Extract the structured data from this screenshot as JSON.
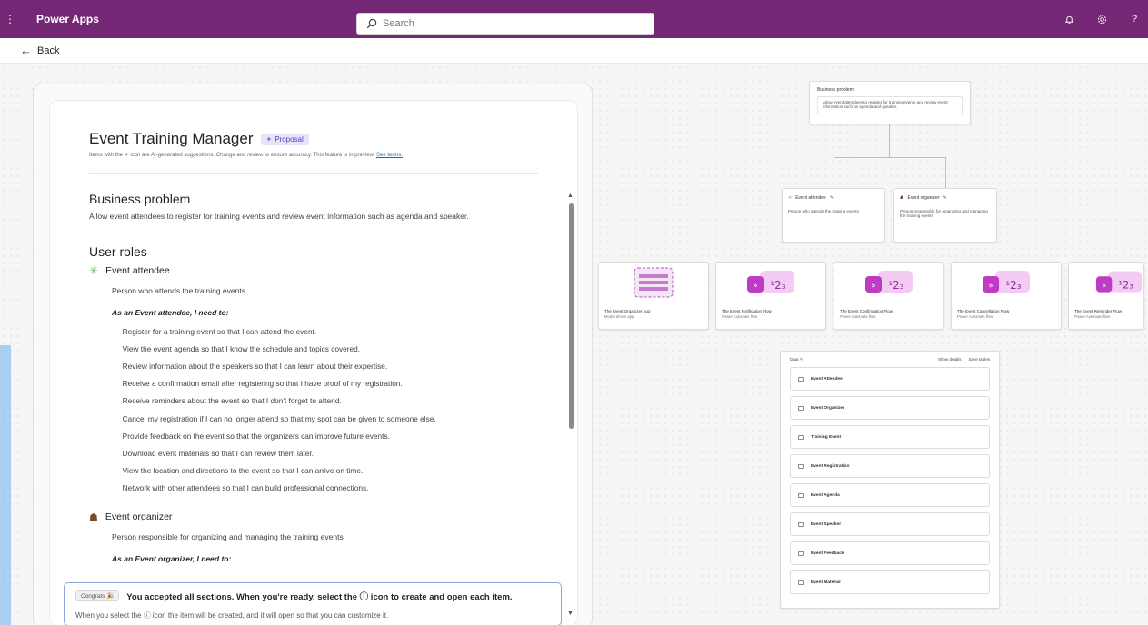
{
  "header": {
    "app_name": "Power Apps",
    "search_placeholder": "Search",
    "icons": [
      "waffle-icon",
      "bell-icon",
      "settings-icon",
      "help-icon"
    ],
    "help_label": "?"
  },
  "back": {
    "label": "Back"
  },
  "plan": {
    "title": "Event Training Manager",
    "badge": "Proposal",
    "ai_note": "Items with the ✦ icon are AI-generated suggestions. Change and review to ensure accuracy. This feature is in preview.",
    "ai_note_link": "See terms.",
    "business_problem_title": "Business problem",
    "business_problem_text": "Allow event attendees to register for training events and review event information such as agenda and speaker.",
    "user_roles_title": "User roles",
    "roles": [
      {
        "name": "Event attendee",
        "description": "Person who attends the training events",
        "need_title": "As an Event attendee, I need to:",
        "stories": [
          "Register for a training event so that I can attend the event.",
          "View the event agenda so that I know the schedule and topics covered.",
          "Review information about the speakers so that I can learn about their expertise.",
          "Receive a confirmation email after registering so that I have proof of my registration.",
          "Receive reminders about the event so that I don't forget to attend.",
          "Cancel my registration if I can no longer attend so that my spot can be given to someone else.",
          "Provide feedback on the event so that the organizers can improve future events.",
          "Download event materials so that I can review them later.",
          "View the location and directions to the event so that I can arrive on time.",
          "Network with other attendees so that I can build professional connections."
        ]
      },
      {
        "name": "Event organizer",
        "description": "Person responsible for organizing and managing the training events",
        "need_title": "As an Event organizer, I need to:"
      }
    ]
  },
  "toast": {
    "badge": "Congrats",
    "message": "You accepted all sections. When you're ready, select the ⓘ icon to create and open each item.",
    "sub": "When you select the ⓘ icon the item will be created, and it will open so that you can customize it."
  },
  "diagram": {
    "business_problem": {
      "title": "Business problem",
      "text": "Allow event attendees to register for training events and review event information such as agenda and speaker."
    },
    "roles": [
      {
        "name": "Event attendee",
        "description": "Person who attends the training events"
      },
      {
        "name": "Event organizer",
        "description": "Person responsible for organizing and managing the training events"
      }
    ],
    "apps": [
      {
        "name": "The Event Organizer App",
        "type": "Model-driven app"
      },
      {
        "name": "The Event Notification Flow",
        "type": "Power Automate flow"
      },
      {
        "name": "The Event Confirmation Flow",
        "type": "Power Automate flow"
      },
      {
        "name": "The Event Cancellation Flow",
        "type": "Power Automate flow"
      },
      {
        "name": "The Event Reminder Flow",
        "type": "Power Automate flow"
      }
    ],
    "tables_title": "Data",
    "show_details": "Show details",
    "save_tables": "Save tables",
    "tables": [
      "Event Attendee",
      "Event Organizer",
      "Training Event",
      "Event Registration",
      "Event Agenda",
      "Event Speaker",
      "Event Feedback",
      "Event Material"
    ]
  },
  "colors": {
    "header_bg": "#742774",
    "accent": "#0f6cbd",
    "flow_pink": "#c03bc4"
  }
}
